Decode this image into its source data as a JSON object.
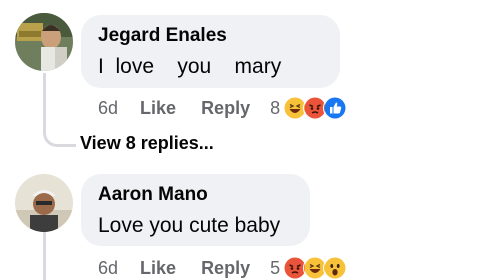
{
  "comments": [
    {
      "author": "Jegard Enales",
      "text": "I  love    you    mary",
      "age": "6d",
      "like_label": "Like",
      "reply_label": "Reply",
      "reaction_count": "8",
      "reactions": [
        "haha-icon",
        "angry-icon",
        "like-icon"
      ]
    },
    {
      "author": "Aaron Mano",
      "text": "Love you cute baby",
      "age": "6d",
      "like_label": "Like",
      "reply_label": "Reply",
      "reaction_count": "5",
      "reactions": [
        "angry-icon",
        "haha-icon",
        "wow-icon"
      ]
    }
  ],
  "view_replies_label": "View 8 replies...",
  "colors": {
    "bubble": "#eff1f5",
    "meta_text": "#65676b",
    "thread_line": "#d8dadf",
    "like_blue": "#1877f2",
    "emoji_yellow": "#f7c23a",
    "angry_red": "#e9543a"
  }
}
